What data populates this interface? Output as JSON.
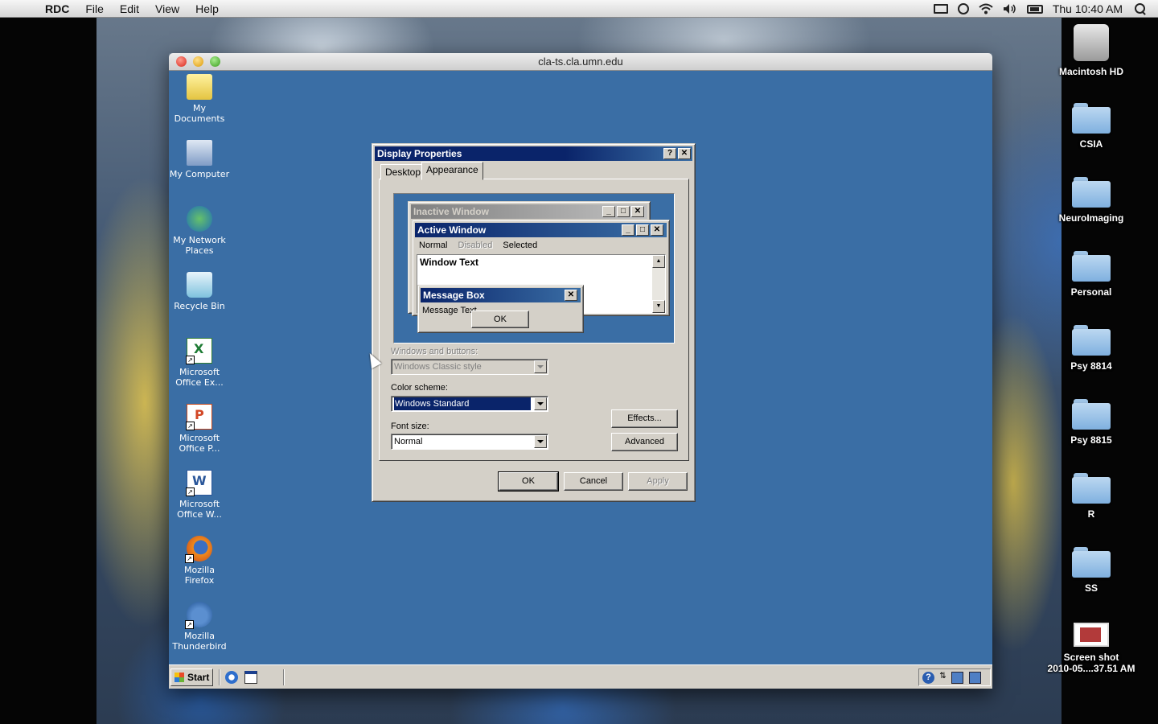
{
  "menubar": {
    "app_name": "RDC",
    "items": [
      "File",
      "Edit",
      "View",
      "Help"
    ],
    "clock": "Thu 10:40 AM"
  },
  "mac_desktop": {
    "icons": [
      {
        "label": "Macintosh HD",
        "icon": "hard-drive-icon"
      },
      {
        "label": "CSIA",
        "icon": "folder-icon"
      },
      {
        "label": "NeuroImaging",
        "icon": "folder-icon"
      },
      {
        "label": "Personal",
        "icon": "folder-icon"
      },
      {
        "label": "Psy 8814",
        "icon": "folder-icon"
      },
      {
        "label": "Psy 8815",
        "icon": "folder-icon"
      },
      {
        "label": "R",
        "icon": "folder-icon"
      },
      {
        "label": "SS",
        "icon": "folder-icon"
      },
      {
        "label": "Screen shot",
        "label2": "2010-05....37.51 AM",
        "icon": "screenshot-file-icon"
      }
    ]
  },
  "rdc_window": {
    "title": "cla-ts.cla.umn.edu"
  },
  "win_desktop": {
    "icons": [
      {
        "label": "My Documents"
      },
      {
        "label": "My Computer"
      },
      {
        "label": "My Network Places"
      },
      {
        "label": "Recycle Bin"
      },
      {
        "label": "Microsoft Office Ex..."
      },
      {
        "label": "Microsoft Office P..."
      },
      {
        "label": "Microsoft Office W..."
      },
      {
        "label": "Mozilla Firefox"
      },
      {
        "label": "Mozilla Thunderbird"
      }
    ]
  },
  "taskbar": {
    "start_label": "Start"
  },
  "dialog": {
    "title": "Display Properties",
    "help_btn": "?",
    "close_btn": "✕",
    "tabs": [
      "Desktop",
      "Appearance"
    ],
    "active_tab": "Appearance",
    "preview": {
      "inactive_title": "Inactive Window",
      "active_title": "Active Window",
      "menu": {
        "normal": "Normal",
        "disabled": "Disabled",
        "selected": "Selected"
      },
      "window_text": "Window Text",
      "msgbox_title": "Message Box",
      "msgbox_text": "Message Text",
      "msgbox_ok": "OK"
    },
    "windows_buttons_label": "Windows and buttons:",
    "windows_buttons_value": "Windows Classic style",
    "color_scheme_label": "Color scheme:",
    "color_scheme_value": "Windows Standard",
    "font_size_label": "Font size:",
    "font_size_value": "Normal",
    "effects_btn": "Effects...",
    "advanced_btn": "Advanced",
    "ok_btn": "OK",
    "cancel_btn": "Cancel",
    "apply_btn": "Apply"
  },
  "colors": {
    "win_desktop_bg": "#3a6ea5",
    "classic_face": "#d4d0c8",
    "active_caption": "#0a246a",
    "inactive_caption": "#808080"
  }
}
